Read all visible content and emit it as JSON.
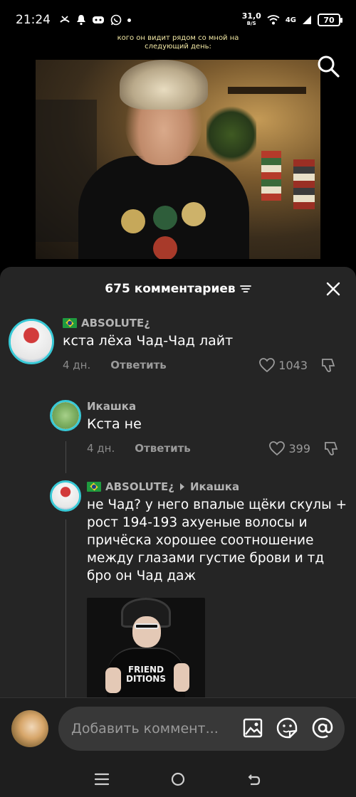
{
  "status_bar": {
    "time": "21:24",
    "net_speed": "31,0",
    "net_unit": "B/S",
    "network": "4G",
    "battery": "70"
  },
  "video": {
    "caption_line1": "кого он видит рядом со мной на",
    "caption_line2": "следующий день:"
  },
  "comments_sheet": {
    "title": "675 комментариев",
    "comments": [
      {
        "username": "ABSOLUTE¿",
        "text": "кста лёха Чад-Чад лайт",
        "time": "4 дн.",
        "reply_label": "Ответить",
        "likes": "1043"
      },
      {
        "username": "Икашка",
        "text": "Кста не",
        "time": "4 дн.",
        "reply_label": "Ответить",
        "likes": "399"
      },
      {
        "username": "ABSOLUTE¿",
        "reply_to": "Икашка",
        "text": "не Чад? у него впалые щёки скулы + рост 194-193 ахуеные волосы и причёска хорошее соотношение между глазами густие брови и тд бро он Чад даж",
        "image_text_line1": "FRIEND",
        "image_text_line2": "DITIONS"
      }
    ]
  },
  "input": {
    "placeholder": "Добавить коммент..."
  },
  "colors": {
    "sheet_bg": "#252525",
    "avatar_ring": "#38c9d6",
    "muted_text": "#8a8a8a"
  }
}
